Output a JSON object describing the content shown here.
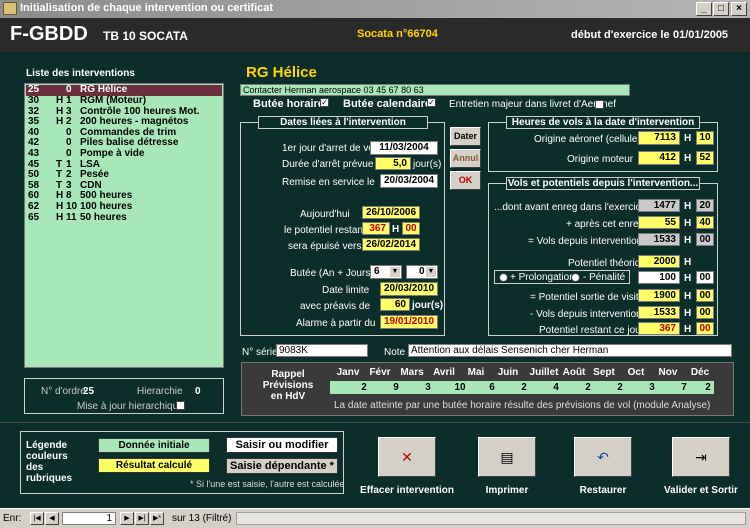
{
  "window": {
    "title": "Initialisation de chaque intervention ou certificat"
  },
  "header": {
    "aircraft": "F-GBDD",
    "model": "TB 10 SOCATA",
    "serial": "Socata n°66704",
    "exercise_label": "début d'exercice le",
    "exercise_date": "01/01/2005"
  },
  "list": {
    "title": "Liste des interventions",
    "items": [
      {
        "c1": "25",
        "c2": "",
        "c3": "0",
        "name": "RG Hélice"
      },
      {
        "c1": "30",
        "c2": "H",
        "c3": "1",
        "name": "RGM (Moteur)"
      },
      {
        "c1": "32",
        "c2": "H",
        "c3": "3",
        "name": "Contrôle 100 heures Mot."
      },
      {
        "c1": "35",
        "c2": "H",
        "c3": "2",
        "name": "200 heures - magnétos"
      },
      {
        "c1": "40",
        "c2": "",
        "c3": "0",
        "name": "Commandes de trim"
      },
      {
        "c1": "42",
        "c2": "",
        "c3": "0",
        "name": "Piles balise détresse"
      },
      {
        "c1": "43",
        "c2": "",
        "c3": "0",
        "name": "Pompe à vide"
      },
      {
        "c1": "45",
        "c2": "T",
        "c3": "1",
        "name": "LSA"
      },
      {
        "c1": "50",
        "c2": "T",
        "c3": "2",
        "name": "Pesée"
      },
      {
        "c1": "58",
        "c2": "T",
        "c3": "3",
        "name": "CDN"
      },
      {
        "c1": "60",
        "c2": "H",
        "c3": "8",
        "name": "500 heures"
      },
      {
        "c1": "62",
        "c2": "H",
        "c3": "10",
        "name": "100 heures"
      },
      {
        "c1": "65",
        "c2": "H",
        "c3": "11",
        "name": "50 heures"
      }
    ],
    "ordre_label": "N° d'ordre",
    "ordre_value": "25",
    "hierarchie_label": "Hierarchie",
    "hierarchie_value": "0",
    "maj_label": "Mise à jour hierarchique"
  },
  "intervention": {
    "title": "RG Hélice",
    "contact": "Contacter Herman aerospace 03 45 67 80 63",
    "butee_horaire": "Butée horaire",
    "butee_calendaire": "Butée calendaire",
    "entretien_majeur": "Entretien majeur dans livret d'Aeronef",
    "check": "✓"
  },
  "dates": {
    "title": "Dates liées à l'intervention",
    "arret_label": "1er jour d'arret de vol",
    "arret_value": "11/03/2004",
    "duree_label": "Durée d'arrêt prévue",
    "duree_value": "5,0",
    "duree_unit": "jour(s)",
    "remise_label": "Remise en service le",
    "remise_value": "20/03/2004",
    "aujourdhui_label": "Aujourd'hui",
    "aujourdhui_value": "26/10/2006",
    "restant_label": "le potentiel restant",
    "restant_h": "367",
    "restant_h_unit": "H",
    "restant_m": "00",
    "epuise_label": "sera épuisé vers le",
    "epuise_value": "26/02/2014",
    "butee_label": "Butée (An + Jours)",
    "butee_an": "6",
    "butee_jours": "0",
    "limite_label": "Date limite",
    "limite_value": "20/03/2010",
    "preavis_label": "avec préavis de",
    "preavis_value": "60",
    "preavis_unit": "jour(s)",
    "alarme_label": "Alarme à partir du",
    "alarme_value": "19/01/2010"
  },
  "side_buttons": {
    "dater": "Dater",
    "annul": "Annul",
    "ok": "OK"
  },
  "heures": {
    "title": "Heures de vols à la date d'intervention",
    "origine_aeronef_label": "Origine aéronef (cellule)",
    "origine_aeronef_h": "7113",
    "origine_aeronef_m": "10",
    "origine_moteur_label": "Origine moteur",
    "origine_moteur_h": "412",
    "origine_moteur_m": "52",
    "h_unit": "H"
  },
  "vols": {
    "title": "Vols et potentiels depuis l'intervention...",
    "exercice_label": "...dont avant enreg dans l'exercice",
    "exercice_h": "1477",
    "exercice_m": "20",
    "apres_label": "+ après cet enreg.",
    "apres_h": "55",
    "apres_m": "40",
    "depuis_label": "= Vols depuis intervention",
    "depuis_h": "1533",
    "depuis_m": "00",
    "theorique_label": "Potentiel théorique",
    "theorique_h": "2000",
    "prolongation_label": "+ Prolongation",
    "penalite_label": "- Pénalité",
    "penalite_h": "100",
    "penalite_m": "00",
    "sortie_label": "= Potentiel sortie de visite",
    "sortie_h": "1900",
    "sortie_m": "00",
    "vols_label": "- Vols depuis intervention",
    "vols_h": "1533",
    "vols_m": "00",
    "restant_label": "Potentiel restant ce jour",
    "restant_h": "367",
    "restant_m": "00",
    "h_unit": "H"
  },
  "serie": {
    "label": "N° série",
    "value": "9083K",
    "note_label": "Note",
    "note_value": "Attention aux délais Sensenich cher Herman"
  },
  "rappel": {
    "title_l1": "Rappel",
    "title_l2": "Prévisions",
    "title_l3": "en HdV",
    "months": [
      "Janv",
      "Févr",
      "Mars",
      "Avril",
      "Mai",
      "Juin",
      "Juillet",
      "Août",
      "Sept",
      "Oct",
      "Nov",
      "Déc"
    ],
    "values": [
      "2",
      "9",
      "3",
      "10",
      "6",
      "2",
      "4",
      "2",
      "2",
      "3",
      "7",
      "2"
    ],
    "footnote": "La date atteinte par une butée horaire résulte des prévisions de vol (module Analyse)"
  },
  "legend": {
    "title_l1": "Légende",
    "title_l2": "couleurs",
    "title_l3": "des",
    "title_l4": "rubriques",
    "initial": "Donnée initiale",
    "saisir": "Saisir ou modifier",
    "calcule": "Résultat calculé",
    "dependante": "Saisie dépendante *",
    "note": "* Si l'une est saisie, l'autre est calculée"
  },
  "actions": {
    "effacer": "Effacer intervention",
    "imprimer": "Imprimer",
    "restaurer": "Restaurer",
    "valider": "Valider et Sortir"
  },
  "nav": {
    "label": "Enr:",
    "record": "1",
    "total": "sur  13 (Filtré)"
  }
}
